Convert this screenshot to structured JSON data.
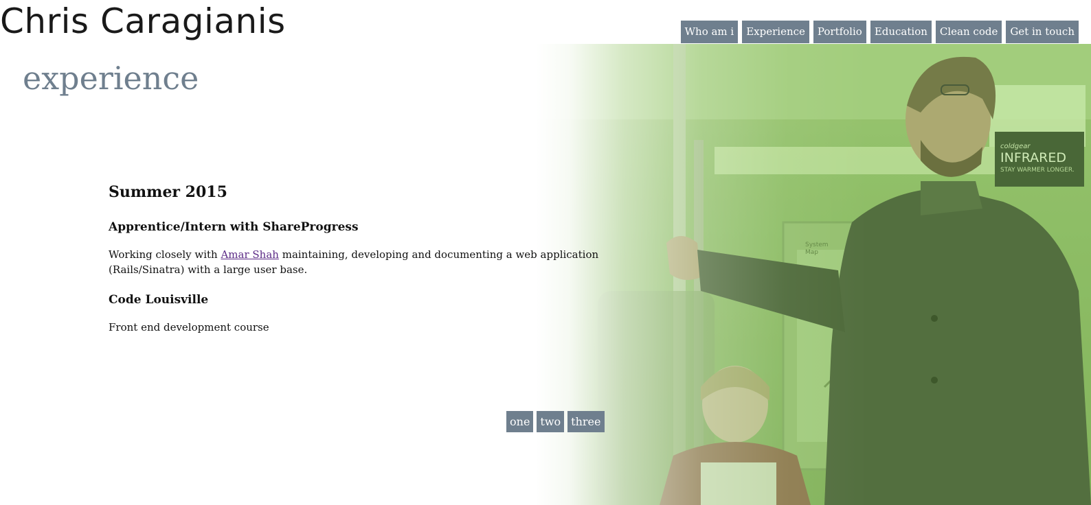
{
  "site": {
    "name": "Chris Caragianis"
  },
  "nav": {
    "items": [
      {
        "label": "Who am i"
      },
      {
        "label": "Experience"
      },
      {
        "label": "Portfolio"
      },
      {
        "label": "Education"
      },
      {
        "label": "Clean code"
      },
      {
        "label": "Get in touch"
      }
    ]
  },
  "section": {
    "title": "experience"
  },
  "experience": {
    "period": "Summer 2015",
    "roles": [
      {
        "title": "Apprentice/Intern with ShareProgress",
        "desc_before": "Working closely with ",
        "link_text": "Amar Shah",
        "desc_after": " maintaining, developing and documenting a web application (Rails/Sinatra) with a large user base."
      },
      {
        "title": "Code Louisville",
        "desc": "Front end development course"
      }
    ]
  },
  "pager": {
    "items": [
      {
        "label": "one"
      },
      {
        "label": "two"
      },
      {
        "label": "three"
      }
    ]
  },
  "photo": {
    "sign_brand": "coldgear",
    "sign_title": "INFRARED",
    "sign_tagline": "STAY WARMER LONGER.",
    "map_label_top": "System",
    "map_label_bottom": "Map"
  },
  "colors": {
    "accent": "#6f7f8e",
    "link_visited": "#5b2a86",
    "photo_tint": "#8fb86c"
  }
}
